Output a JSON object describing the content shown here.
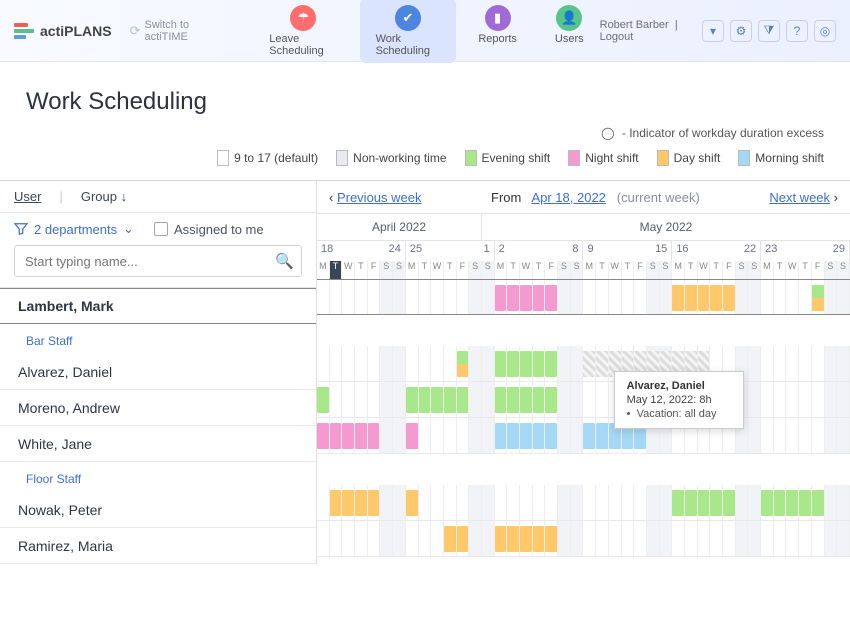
{
  "app": {
    "name": "actiPLANS",
    "switch_label": "Switch to actiTIME"
  },
  "nav": {
    "items": [
      {
        "label": "Leave Scheduling"
      },
      {
        "label": "Work Scheduling"
      },
      {
        "label": "Reports"
      },
      {
        "label": "Users"
      }
    ],
    "active": 1
  },
  "header": {
    "user": "Robert Barber",
    "logout": "Logout"
  },
  "page": {
    "title": "Work Scheduling",
    "duration_note": " - Indicator of workday duration excess"
  },
  "legend": [
    {
      "label": "9 to 17 (default)",
      "color": "#ffffff"
    },
    {
      "label": "Non-working time",
      "color": "#e9ebf1"
    },
    {
      "label": "Evening shift",
      "color": "#a8e88a"
    },
    {
      "label": "Night shift",
      "color": "#f49ad0"
    },
    {
      "label": "Day shift",
      "color": "#ffc96b"
    },
    {
      "label": "Morning shift",
      "color": "#a4d8f4"
    }
  ],
  "colors": {
    "default": "#ffffff",
    "nonworking": "#e9ebf1",
    "evening": "#a8e88a",
    "night": "#f49ad0",
    "day": "#ffc96b",
    "morning": "#a4d8f4",
    "vacation_stripe": "#cccccc"
  },
  "userpanel": {
    "sort_user": "User",
    "sort_group": "Group",
    "active_sort": "user",
    "dept_filter": "2 departments",
    "assigned_label": "Assigned to me",
    "search_placeholder": "Start typing name..."
  },
  "datebar": {
    "prev": "Previous week",
    "from_label": "From",
    "picker": "Apr 18, 2022",
    "current_note": "(current week)",
    "next": "Next week"
  },
  "months": [
    {
      "label": "April 2022",
      "span": 13
    },
    {
      "label": "May 2022",
      "span": 29
    }
  ],
  "weeks": [
    {
      "from": "18",
      "to": "24"
    },
    {
      "from": "25",
      "to": "1"
    },
    {
      "from": "2",
      "to": "8"
    },
    {
      "from": "9",
      "to": "15"
    },
    {
      "from": "16",
      "to": "22"
    },
    {
      "from": "23",
      "to": "29"
    }
  ],
  "dow": [
    "M",
    "T",
    "W",
    "T",
    "F",
    "S",
    "S"
  ],
  "current_day_index": 1,
  "groups": [
    {
      "title": null,
      "users": [
        {
          "name": "Lambert, Mark",
          "days": [
            "",
            "",
            "",
            "",
            "",
            "we",
            "we",
            "",
            "",
            "",
            "",
            "",
            "we",
            "we",
            "night",
            "night",
            "night",
            "night",
            "night",
            "we",
            "we",
            "",
            "",
            "",
            "",
            "",
            "we",
            "we",
            "day",
            "day",
            "day",
            "day",
            "day",
            "we",
            "we",
            "",
            "",
            "",
            "",
            "split:evening/day",
            "we",
            "we"
          ]
        }
      ]
    },
    {
      "title": "Bar Staff",
      "users": [
        {
          "name": "Alvarez, Daniel",
          "days": [
            "",
            "",
            "",
            "",
            "",
            "we",
            "we",
            "",
            "",
            "",
            "",
            "split:evening/day",
            "we",
            "we",
            "evening",
            "evening",
            "evening",
            "evening",
            "evening",
            "we",
            "we",
            "vac",
            "vac",
            "vac",
            "vac",
            "vac",
            "vac",
            "vac",
            "vac",
            "vac",
            "vac",
            "",
            "",
            "we",
            "we",
            "",
            "",
            "",
            "",
            "",
            "we",
            "we"
          ]
        },
        {
          "name": "Moreno, Andrew",
          "days": [
            "evening",
            "",
            "",
            "",
            "",
            "we",
            "we",
            "evening",
            "evening",
            "evening",
            "evening",
            "evening",
            "we",
            "we",
            "evening",
            "evening",
            "evening",
            "evening",
            "evening",
            "we",
            "we",
            "",
            "",
            "",
            "",
            "",
            "we",
            "we",
            "",
            "",
            "",
            "",
            "",
            "we",
            "we",
            "",
            "",
            "",
            "",
            "",
            "we",
            "we"
          ]
        },
        {
          "name": "White, Jane",
          "days": [
            "night",
            "night",
            "night",
            "night",
            "night",
            "we",
            "we",
            "night",
            "",
            "",
            "",
            "",
            "we",
            "we",
            "morning",
            "morning",
            "morning",
            "morning",
            "morning",
            "we",
            "we",
            "morning",
            "morning",
            "morning",
            "morning",
            "morning",
            "we",
            "we",
            "",
            "",
            "",
            "",
            "",
            "we",
            "we",
            "",
            "",
            "",
            "",
            "",
            "we",
            "we"
          ]
        }
      ]
    },
    {
      "title": "Floor Staff",
      "users": [
        {
          "name": "Nowak, Peter",
          "days": [
            "",
            "day",
            "day",
            "day",
            "day",
            "we",
            "we",
            "day",
            "",
            "",
            "",
            "",
            "we",
            "we",
            "",
            "",
            "",
            "",
            "",
            "we",
            "we",
            "",
            "",
            "",
            "",
            "",
            "we",
            "we",
            "evening",
            "evening",
            "evening",
            "evening",
            "evening",
            "we",
            "we",
            "evening",
            "evening",
            "evening",
            "evening",
            "evening",
            "we",
            "we"
          ]
        },
        {
          "name": "Ramirez, Maria",
          "days": [
            "",
            "",
            "",
            "",
            "",
            "we",
            "we",
            "",
            "",
            "",
            "day",
            "day",
            "we",
            "we",
            "day",
            "day",
            "day",
            "day",
            "day",
            "we",
            "we",
            "",
            "",
            "",
            "",
            "",
            "we",
            "we",
            "",
            "",
            "",
            "",
            "",
            "we",
            "we",
            "",
            "",
            "",
            "",
            "",
            "we",
            "we"
          ]
        }
      ]
    }
  ],
  "tooltip": {
    "user": "Alvarez, Daniel",
    "date": "May 12, 2022: 8h",
    "item": "Vacation: all day",
    "day_index": 24
  },
  "chart_data": {
    "type": "gantt-schedule",
    "date_range": {
      "start": "2022-04-18",
      "end": "2022-05-29"
    },
    "shift_types": [
      "9 to 17 (default)",
      "Non-working time",
      "Evening shift",
      "Night shift",
      "Day shift",
      "Morning shift"
    ],
    "users": [
      {
        "group": null,
        "name": "Lambert, Mark",
        "assignments": [
          {
            "start": "2022-05-02",
            "end": "2022-05-06",
            "shift": "Night shift"
          },
          {
            "start": "2022-05-16",
            "end": "2022-05-20",
            "shift": "Day shift"
          },
          {
            "date": "2022-05-27",
            "shift": "Evening shift / Day shift (split)"
          }
        ]
      },
      {
        "group": "Bar Staff",
        "name": "Alvarez, Daniel",
        "assignments": [
          {
            "date": "2022-04-29",
            "shift": "Evening shift / Day shift (split)"
          },
          {
            "start": "2022-05-02",
            "end": "2022-05-06",
            "shift": "Evening shift"
          },
          {
            "start": "2022-05-09",
            "end": "2022-05-19",
            "shift": "Vacation"
          }
        ]
      },
      {
        "group": "Bar Staff",
        "name": "Moreno, Andrew",
        "assignments": [
          {
            "date": "2022-04-18",
            "shift": "Evening shift"
          },
          {
            "start": "2022-04-25",
            "end": "2022-04-29",
            "shift": "Evening shift"
          },
          {
            "start": "2022-05-02",
            "end": "2022-05-06",
            "shift": "Evening shift"
          }
        ]
      },
      {
        "group": "Bar Staff",
        "name": "White, Jane",
        "assignments": [
          {
            "start": "2022-04-18",
            "end": "2022-04-22",
            "shift": "Night shift"
          },
          {
            "date": "2022-04-25",
            "shift": "Night shift"
          },
          {
            "start": "2022-05-02",
            "end": "2022-05-06",
            "shift": "Morning shift"
          },
          {
            "start": "2022-05-09",
            "end": "2022-05-13",
            "shift": "Morning shift"
          }
        ]
      },
      {
        "group": "Floor Staff",
        "name": "Nowak, Peter",
        "assignments": [
          {
            "start": "2022-04-19",
            "end": "2022-04-22",
            "shift": "Day shift"
          },
          {
            "date": "2022-04-25",
            "shift": "Day shift"
          },
          {
            "start": "2022-05-16",
            "end": "2022-05-20",
            "shift": "Evening shift"
          },
          {
            "start": "2022-05-23",
            "end": "2022-05-27",
            "shift": "Evening shift"
          }
        ]
      },
      {
        "group": "Floor Staff",
        "name": "Ramirez, Maria",
        "assignments": [
          {
            "start": "2022-04-28",
            "end": "2022-04-29",
            "shift": "Day shift"
          },
          {
            "start": "2022-05-02",
            "end": "2022-05-06",
            "shift": "Day shift"
          }
        ]
      }
    ]
  }
}
